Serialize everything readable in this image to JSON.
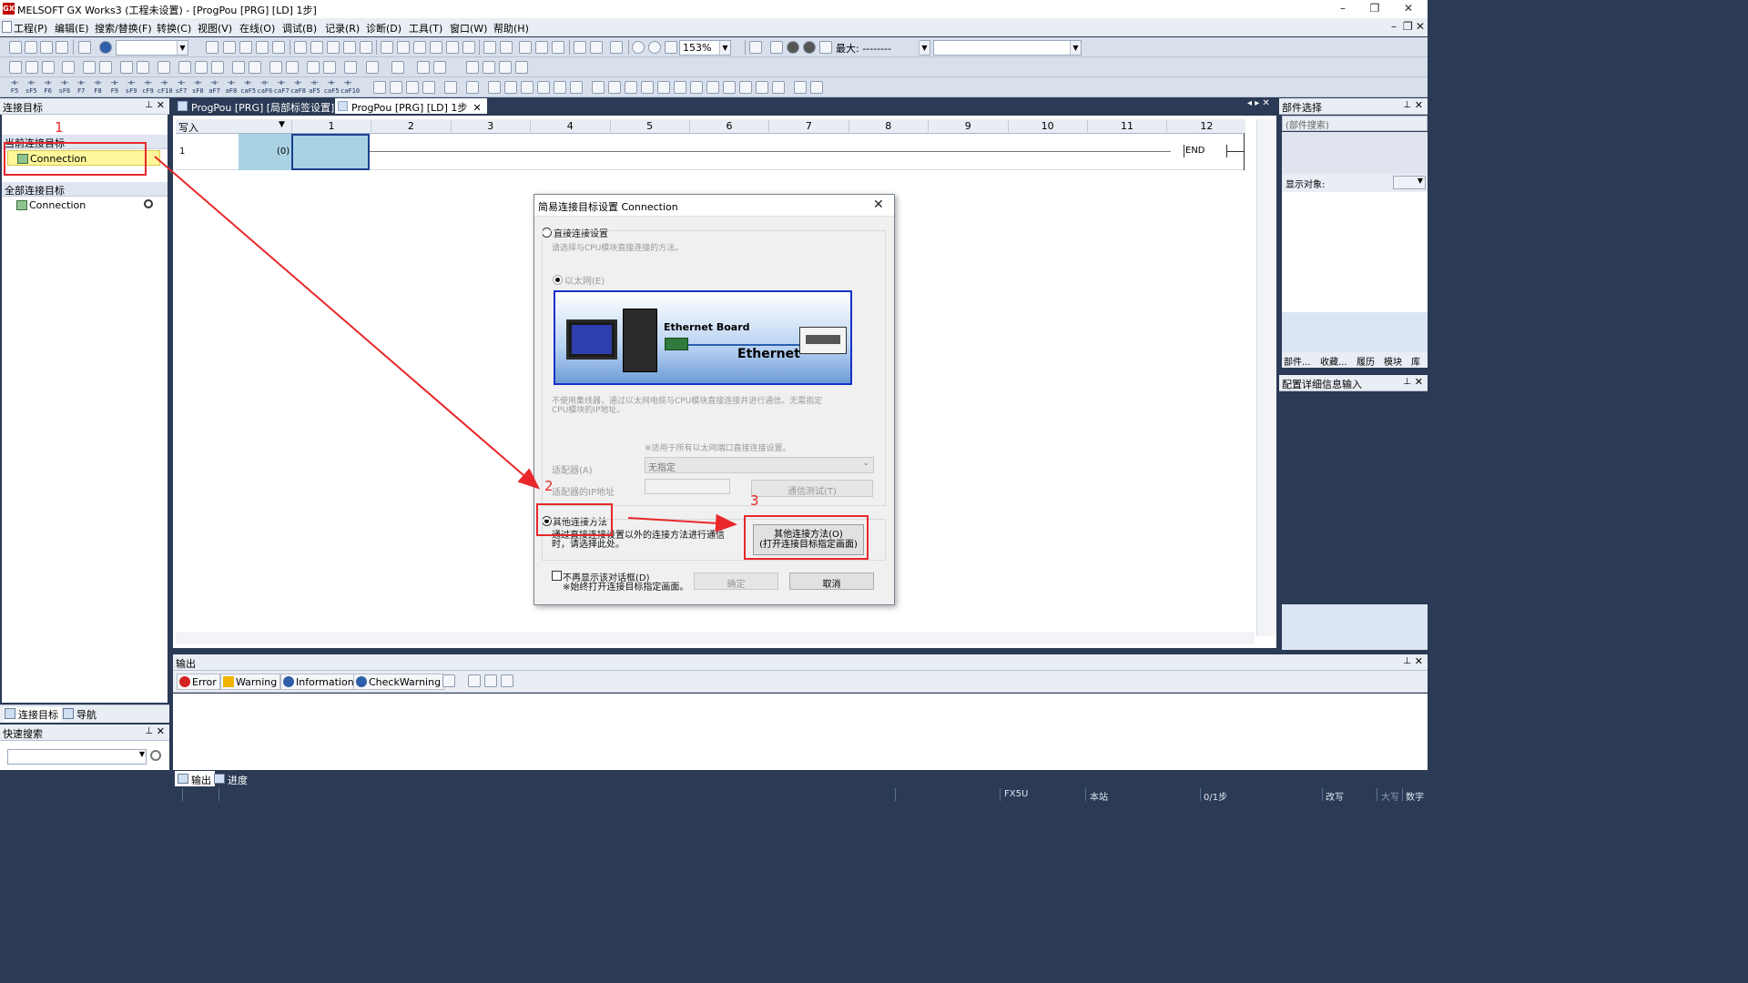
{
  "window": {
    "title": "MELSOFT GX Works3 (工程未设置) - [ProgPou [PRG] [LD] 1步]",
    "app_icon": "GX"
  },
  "menu": [
    "工程(P)",
    "编辑(E)",
    "搜索/替换(F)",
    "转换(C)",
    "视图(V)",
    "在线(O)",
    "调试(B)",
    "记录(R)",
    "诊断(D)",
    "工具(T)",
    "窗口(W)",
    "帮助(H)"
  ],
  "toolbar": {
    "zoom": "153%",
    "max_label": "最大: --------",
    "combo1": "",
    "combo2": ""
  },
  "fkeys": [
    "F5",
    "sF5",
    "F6",
    "sF6",
    "F7",
    "F8",
    "F9",
    "sF9",
    "cF9",
    "cF10",
    "sF7",
    "sF8",
    "aF7",
    "aF8",
    "caF5",
    "caF6",
    "caF7",
    "caF8",
    "aF5",
    "caF5",
    "caF10"
  ],
  "left_panel": {
    "title": "连接目标",
    "current_section": "当前连接目标",
    "current_item": "Connection",
    "all_section": "全部连接目标",
    "all_item": "Connection",
    "tabs": [
      "连接目标",
      "导航"
    ],
    "quick_search_title": "快速搜索"
  },
  "doc_tabs": [
    {
      "label": "ProgPou [PRG] [局部标签设置]"
    },
    {
      "label": "ProgPou [PRG] [LD] 1步",
      "close": "✕"
    }
  ],
  "editor": {
    "mode_label": "写入",
    "columns": [
      "1",
      "2",
      "3",
      "4",
      "5",
      "6",
      "7",
      "8",
      "9",
      "10",
      "11",
      "12"
    ],
    "row_number": "1",
    "step_label": "(0)",
    "end_label": "END"
  },
  "right_panel": {
    "parts_title": "部件选择",
    "parts_search": "(部件搜索)",
    "display_label": "显示对象:",
    "tabs": [
      "部件...",
      "收藏...",
      "履历",
      "模块",
      "库"
    ],
    "detail_title": "配置详细信息输入"
  },
  "output": {
    "title": "输出",
    "buttons": [
      "Error",
      "Warning",
      "Information",
      "CheckWarning"
    ],
    "tabs": [
      "输出",
      "进度"
    ]
  },
  "status": {
    "cpu": "FX5U",
    "station": "本站",
    "steps": "0/1步",
    "mode": "改写",
    "caps": "大写",
    "num": "数字"
  },
  "dialog": {
    "title": "简易连接目标设置 Connection",
    "direct_label": "直接连接设置",
    "direct_desc": "请选择与CPU模块直接连接的方法。",
    "ethernet_label": "以太网(E)",
    "image_board": "Ethernet Board",
    "image_net": "Ethernet",
    "ethernet_note": "不使用集线器，通过以太网电缆与CPU模块直接连接并进行通信。无需指定CPU模块的IP地址。",
    "apply_note": "※适用于所有以太网端口直接连接设置。",
    "adapter_label": "适配器(A)",
    "adapter_value": "无指定",
    "adapter_ip_label": "适配器的IP地址",
    "comm_test": "通信测试(T)",
    "other_label": "其他连接方法",
    "other_desc": "通过直接连接设置以外的连接方法进行通信时，请选择此处。",
    "other_button_line1": "其他连接方法(O)",
    "other_button_line2": "(打开连接目标指定画面)",
    "no_show_label": "不再显示该对话框(D)",
    "no_show_note": "※始终打开连接目标指定画面。",
    "ok": "确定",
    "cancel": "取消"
  },
  "annotations": [
    "1",
    "2",
    "3"
  ],
  "colors": {
    "annotation_red": "#e8282b",
    "panel_dark": "#2b3a55",
    "selection_yellow": "#fff79a"
  }
}
